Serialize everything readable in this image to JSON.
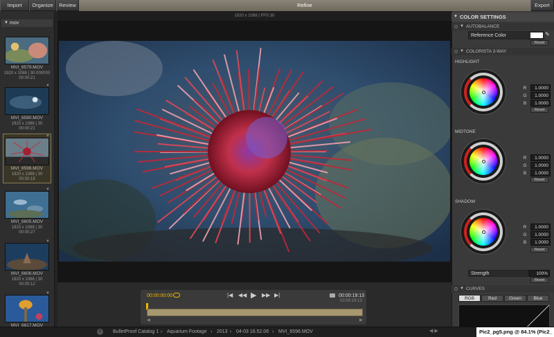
{
  "topbar": {
    "import": "Import",
    "organize": "Organize",
    "review": "Review",
    "refine": "Refine",
    "export": "Export"
  },
  "library": {
    "bin_name": "mov",
    "clips": [
      {
        "name": "MVI_6579.MOV",
        "info": "1920 x 1088 | 30.000000",
        "duration": "00:00:21",
        "selected": false
      },
      {
        "name": "MVI_6580.MOV",
        "info": "1920 x 1088 | 30",
        "duration": "00:00:21",
        "selected": false
      },
      {
        "name": "MVI_6596.MOV",
        "info": "1920 x 1088 | 30",
        "duration": "00:00:19",
        "selected": true
      },
      {
        "name": "MVI_6605.MOV",
        "info": "1920 x 1088 | 30",
        "duration": "00:00:27",
        "selected": false
      },
      {
        "name": "MVI_6606.MOV",
        "info": "1920 x 1088 | 30",
        "duration": "00:00:12",
        "selected": false
      },
      {
        "name": "MVI_6617.MOV",
        "info": "",
        "duration": "",
        "selected": false
      }
    ]
  },
  "viewer": {
    "info": "1920 x 1088 | FPS:30"
  },
  "timecode": {
    "in": "00:00:00:00",
    "current": "00:00:19:13",
    "duration": "00:00:19:13"
  },
  "color_settings": {
    "title": "COLOR SETTINGS",
    "autobalance": {
      "title": "AUTOBALANCE",
      "reference_label": "Reference Color",
      "reset": "Reset"
    },
    "colorista": {
      "title": "COLORISTA 3-WAY",
      "highlight": {
        "label": "HIGHLIGHT",
        "r": "1.0000",
        "g": "1.0000",
        "b": "1.0000",
        "reset": "Reset"
      },
      "midtone": {
        "label": "MIDTONE",
        "r": "1.0000",
        "g": "1.0000",
        "b": "1.0000",
        "reset": "Reset"
      },
      "shadow": {
        "label": "SHADOW",
        "r": "1.0000",
        "g": "1.0000",
        "b": "1.0000",
        "reset": "Reset"
      },
      "strength_label": "Strength",
      "strength_value": "100%",
      "strength_reset": "Reset"
    },
    "curves": {
      "title": "CURVES",
      "tabs": [
        "RGB",
        "Red",
        "Green",
        "Blue"
      ],
      "active_tab": "RGB"
    }
  },
  "status": {
    "crumbs": [
      "BulletProof Catalog 1",
      "Aquarium Footage",
      "2013",
      "04-03 16.52.06",
      "MVI_6596.MOV"
    ],
    "file_tag": "Pic2_pg5.png @ 84.1% (Pic2_"
  },
  "colors": {
    "accent": "#f0b800",
    "refine_bar": "#8b8478",
    "selected_clip": "#3a3627"
  }
}
